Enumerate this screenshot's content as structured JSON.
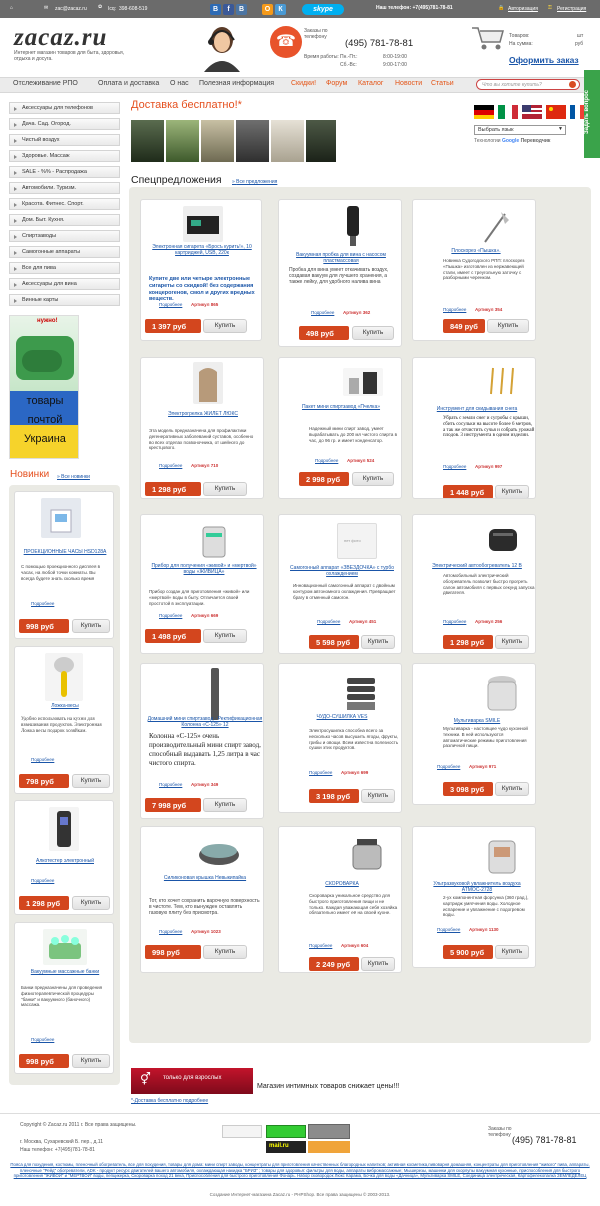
{
  "topbar": {
    "email": "zac@zacaz.ru",
    "icq_label": "Icq:",
    "icq": "398-608-519",
    "phone_label": "Наш телефон: +7(495)781-78-81",
    "login": "Авторизация",
    "register": "Регистрация",
    "social": [
      "B",
      "f",
      "В",
      "О",
      "К"
    ],
    "skype": "skype"
  },
  "header": {
    "logo": "zacaz.ru",
    "tagline": "Интернет магазин товаров для быта, здоровья, отдыха и досуга.",
    "call_label": "Заказы по телефону",
    "phone": "(495) 781-78-81",
    "hours_label": "Время работы:",
    "hours": [
      {
        "d": "Пн.-Пт.:",
        "t": "8:00-19:00"
      },
      {
        "d": "Сб.-Вс:",
        "t": "9:00-17:00"
      }
    ],
    "cart_goods_label": "Товаров:",
    "cart_goods_unit": "шт",
    "cart_sum_label": "На сумма:",
    "cart_sum_unit": "руб",
    "order_link": "Оформить заказ"
  },
  "nav": {
    "items": [
      "Отслеживание РПО",
      "Оплата и доставка",
      "О нас",
      "Полезная информация",
      "Скидки!",
      "Форум",
      "Каталог",
      "Новости",
      "Статьи"
    ],
    "search_placeholder": "Что вы хотите купить?"
  },
  "translate": {
    "select": "Выбрать язык",
    "powered": "Технологии",
    "google": "Google",
    "translator": "Переводчик"
  },
  "side_tab": "Задать вопрос",
  "sidebar": {
    "items": [
      "Аксессуары для телефонов",
      "Дача. Сад. Огород.",
      "Чистый воздух",
      "Здоровье. Массаж",
      "SALE - %% - Распродажа",
      "Автомобили. Туризм.",
      "Красота. Фитнес. Спорт.",
      "Дом. Быт. Кухня.",
      "Спиртзаводы",
      "Самогонные аппараты",
      "Все для пива",
      "Аксессуары для вина",
      "Винные карты"
    ],
    "banner_top": "нужно!",
    "banner_lines": [
      "товары",
      "почтой",
      "Украина"
    ]
  },
  "novelties": {
    "title": "Новинки",
    "all": "Все новинки",
    "items": [
      {
        "title": "ПРОЕКЦИОННЫЕ ЧАСЫ HSD128A",
        "desc": "С помощью проекционного дисплея в часах, на любой точки комнаты. Вы всегда будете знать сколько время",
        "more": "Подробнее",
        "price": "998 руб",
        "buy": "Купить"
      },
      {
        "title": "Ложка-весы",
        "desc": "Удобно использовать на кухни для взвешивания продуктов. Электронная Ложка весы подарок хозяйкам.",
        "more": "Подробнее",
        "price": "798 руб",
        "buy": "Купить"
      },
      {
        "title": "Алкотестер электронный",
        "desc": "",
        "more": "Подробнее",
        "price": "1 298 руб",
        "buy": "Купить"
      },
      {
        "title": "Вакуумные массажные банки",
        "desc": "Банки предназначены для проведения физиотерапевтической процедуры \"банки\" и вакуумного (баночного) массажа.",
        "more": "Подробнее",
        "price": "998 руб",
        "buy": "Купить"
      }
    ]
  },
  "main": {
    "delivery_title": "Доставка бесплатно!*",
    "spec_title": "Спецпредложения",
    "spec_all": "Все предложения",
    "products": [
      {
        "title": "Электронная сигарета «Бросъ курить!», 10 картриджей, USB, 220к",
        "desc": "Купите две или четыре электронные сигареты со скидкой! без содержания концерогенов, смол и других вредных веществ.",
        "more": "Подробнее",
        "art": "Артикул 865",
        "price": "1 397 руб",
        "buy": "Купить"
      },
      {
        "title": "Вакуумная пробка для вина с насосом пластмассовая",
        "desc": "Пробка для вина умеет откачивать воздух, создавая вакуум для лучшего хранения, а также лейку, для удобного налива вина",
        "more": "Подробнее",
        "art": "Артикул 362",
        "price": "498 руб",
        "buy": "Купить"
      },
      {
        "title": "Плоскорез «Пышка».",
        "desc": "Новинка Судогодского РПП: плоскорез «Пышка» изготовлен из нержавеющей стали, имеет с треугольную заточку с разборными черенком.",
        "more": "Подробнее",
        "art": "Артикул 354",
        "price": "849 руб",
        "buy": "Купить"
      },
      {
        "title": "Электрогрелка ЖИЛЕТ ЛЮКС",
        "desc": "Эта модель предназначена для профилактики дегенеративных заболеваний суставов, особенно во всех отделах позвоночника, от шейного до крестцового.",
        "more": "Подробнее",
        "art": "Артикул 710",
        "price": "1 298 руб",
        "buy": "Купить"
      },
      {
        "title": "Пакет мини спиртзавод «Пчелка»",
        "desc": "Надежный мини спирт завод, умеет вырабатывать до 200 мл чистого спирта в час, до 96 гр. и имеет конденсатор.",
        "more": "Подробнее",
        "art": "Артикул 524",
        "price": "2 998 руб",
        "buy": "Купить"
      },
      {
        "title": "Инструмент для скидывания снега",
        "desc": "Убрать с земли снег и сугробы с крыши, сбить сосульки на высоте более 6 метров, а так же отчистить сучья и собрать урожай плодов. 3 инструмента в одном изделии.",
        "more": "Подробнее",
        "art": "Артикул 997",
        "price": "1 448 руб",
        "buy": "Купить"
      },
      {
        "title": "Прибор для получения «живой» и «мертвой» воды «ЖИВИЦА»",
        "desc": "Прибор создан для приготовления «живой» или «мертвой» воды в быту. Отличается своей простотой в эксплуатации.",
        "more": "Подробнее",
        "art": "Артикул 669",
        "price": "1 498 руб",
        "buy": "Купить"
      },
      {
        "title": "Самогонный аппарат «ЗВЕЗДОЧКА» с турбо охлаждением",
        "desc": "Инновационный самогонный аппарат с двойным контуром автономного охлаждения. Превращает брагу в отменный самогон.",
        "more": "Подробнее",
        "art": "Артикул 451",
        "price": "5 598 руб",
        "buy": "Купить"
      },
      {
        "title": "Электрический автообогреватель 12 В",
        "desc": "Автомобильный электрический обогреватель позволит быстро прогреть салон автомобиля с первых секунд запуска двигателя.",
        "more": "Подробнее",
        "art": "Артикул 256",
        "price": "1 298 руб",
        "buy": "Купить"
      },
      {
        "title": "Домашний мини спиртзавод - Ректификационная Колонна «С-125» 12",
        "desc": "Колонна «С-125» очень производительный мини спирт завод, способный выдавать 1,25 литра в час чистого спирта.",
        "more": "Подробнее",
        "art": "Артикул 349",
        "price": "7 998 руб",
        "buy": "Купить"
      },
      {
        "title": "ЧУДО-СУШИЛКА VES",
        "desc": "Электросушилка способна всего за несколько часов высушить ягоды, фрукты, грибы и овощи. Всем известна полезность сушки этих продуктов.",
        "more": "Подробнее",
        "art": "Артикул 699",
        "price": "3 198 руб",
        "buy": "Купить"
      },
      {
        "title": "Мультиварка SMILE",
        "desc": "Мультиварка - настоящее чудо кухонной техники. В ней используются автоматические режимы приготовления различной пищи.",
        "more": "Подробнее",
        "art": "Артикул 971",
        "price": "3 098 руб",
        "buy": "Купить"
      },
      {
        "title": "Силиконовая крышка Невыкипайка",
        "desc": "Тот, кто хочет сохранить варочную поверхность в чистоте. Тем, кто вынужден оставлять газовую плиту без присмотра.",
        "more": "Подробнее",
        "art": "Артикул 1023",
        "price": "998 руб",
        "buy": "Купить"
      },
      {
        "title": "СКОРОВАРКА",
        "desc": "Скороварка уникальное средство для быстрого приготовления пищи и не только. Каждая уважающая себя хозяйка обязательно имеет её на своей кухне.",
        "more": "Подробнее",
        "art": "Артикул 604",
        "price": "2 249 руб",
        "buy": "Купить"
      },
      {
        "title": "Ультразвуковой увлажнитель воздуха АТМОС-2728",
        "desc": "2-ух компонентная форсунка (360 град.), картридж умягчения воды. Холодное испарение и увлажнение с подогревом воды.",
        "more": "Подробнее",
        "art": "Артикул 1130",
        "price": "5 900 руб",
        "buy": "Купить"
      }
    ],
    "adult_banner": "только для взрослых",
    "adult_text": "Магазин интимных товаров снижает цены!!!",
    "footnote": "*-Доставка бесплатно подробнее"
  },
  "footer": {
    "copy": "Copyright © Zacaz.ru 2011 г. Все права защищены.",
    "address": "г. Москва, Сухаревский Б. пер., д.11",
    "phone_line": "Наш телефон: +7(495)781-78-81",
    "call_label": "Заказы по телефону",
    "phone": "(495) 781-78-81",
    "seo": "Пояса для похудения, костюмы, пленочный обогреватель, все для похудения, товары для дома: мини спирт заводы, концентраты для приготовления качественных благородных напитков; активная косметика,пивоварня домашняя, концентраты для приготовления \"живого\" пива, аппараты, пленочные \"Рейд\" обогреватели, ADK - продукт ресурс двигателей вашего автомобиля, охлаждающая накидка \"БРИЗ\" ; товары для здоровья: фильтры для воды, аппараты вибромассажные; Мышерезы, машинки для скорлупы вакуумная кухонные, приспособления для быстрого приготовления \"ЖИВОЙ\" и \"МЕРТВОЙ\" воды, пепцикерка, Скороварка поход 21 века, Приспособления для быстрого приготовления Фонарь. Набор сковородок Люкс Карама, Бочка для воды «Дачница», Мультиварка SMILE, Соединица электрическая, Картофелекопалка ЗЕМЛЕДЕЛЕЦ",
    "credits": "Создание Интернет-магазина Zacaz.ru - PHPShop. Все права защищены © 2003-2013."
  },
  "colors": {
    "accent": "#d3461e",
    "link": "#1a55a8",
    "panel": "#eaeae4",
    "nav": "#ebebeb"
  }
}
